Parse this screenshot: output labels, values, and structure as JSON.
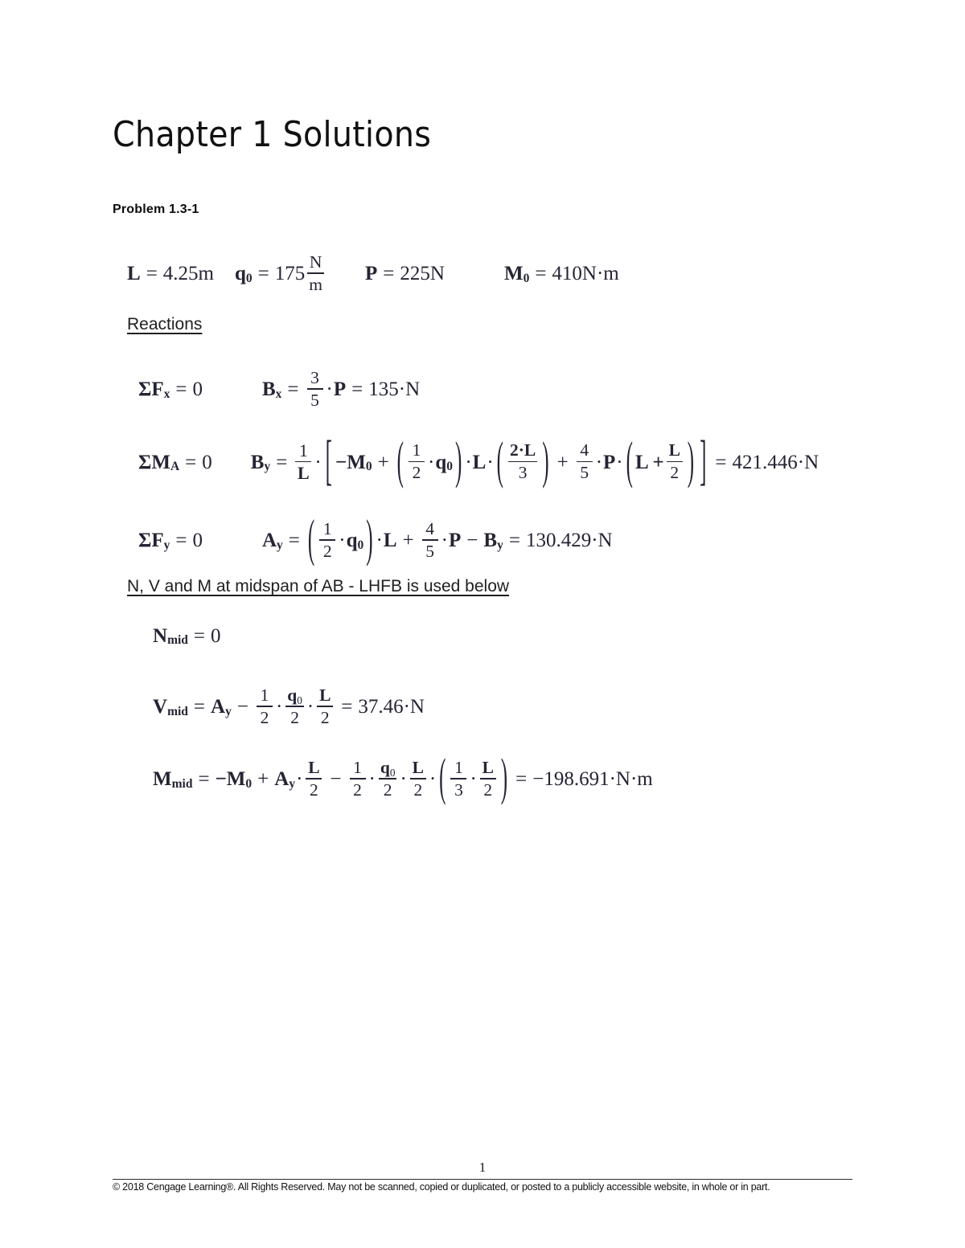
{
  "document": {
    "title": "Chapter 1 Solutions",
    "problem_label": "Problem 1.3-1"
  },
  "givens": {
    "L": {
      "name": "L",
      "eq": "=",
      "value": "4.25m"
    },
    "q0": {
      "name": "q",
      "sub": "0",
      "eq": "=",
      "value": "175",
      "unit_num": "N",
      "unit_den": "m"
    },
    "P": {
      "name": "P",
      "eq": "=",
      "value": "225N"
    },
    "M0": {
      "name": "M",
      "sub": "0",
      "eq": "=",
      "value": "410N·m"
    }
  },
  "sections": {
    "reactions": {
      "heading": "Reactions"
    },
    "nvm": {
      "heading": "N, V and M at midspan of AB - LHFB is used below"
    }
  },
  "equations": {
    "sum_fx": {
      "condition_sym": "ΣF",
      "condition_sub": "x",
      "condition_eq": "=",
      "condition_val": "0",
      "lhs_sym": "B",
      "lhs_sub": "x",
      "frac_num": "3",
      "frac_den": "5",
      "factor": "P",
      "result": "135·N"
    },
    "sum_ma": {
      "condition_sym": "ΣM",
      "condition_sub": "A",
      "condition_eq": "=",
      "condition_val": "0",
      "lhs_sym": "B",
      "lhs_sub": "y",
      "outer_num": "1",
      "outer_den": "L",
      "term1": "−M",
      "term1_sub": "0",
      "t2_num": "1",
      "t2_den": "2",
      "t2_var": "q",
      "t2_var_sub": "0",
      "t2_mult": "L",
      "t3_num": "2·L",
      "t3_den": "3",
      "t4_num": "4",
      "t4_den": "5",
      "t4_var": "P",
      "t5_lead": "L +",
      "t5_num": "L",
      "t5_den": "2",
      "result": "421.446·N"
    },
    "sum_fy": {
      "condition_sym": "ΣF",
      "condition_sub": "y",
      "condition_eq": "=",
      "condition_val": "0",
      "lhs_sym": "A",
      "lhs_sub": "y",
      "t1_num": "1",
      "t1_den": "2",
      "t1_var": "q",
      "t1_var_sub": "0",
      "t1_mult": "L",
      "t2_num": "4",
      "t2_den": "5",
      "t2_var": "P",
      "minus_var": "B",
      "minus_var_sub": "y",
      "result": "130.429·N"
    },
    "n_mid": {
      "lhs_sym": "N",
      "lhs_sub": "mid",
      "eq": "=",
      "result": "0"
    },
    "v_mid": {
      "lhs_sym": "V",
      "lhs_sub": "mid",
      "t1_sym": "A",
      "t1_sub": "y",
      "f1_num": "1",
      "f1_den": "2",
      "f2_num": "q",
      "f2_num_sub": "0",
      "f2_den": "2",
      "f3_num": "L",
      "f3_den": "2",
      "result": "37.46·N"
    },
    "m_mid": {
      "lhs_sym": "M",
      "lhs_sub": "mid",
      "t1": "−M",
      "t1_sub": "0",
      "t2_sym": "A",
      "t2_sub": "y",
      "f0_num": "L",
      "f0_den": "2",
      "f1_num": "1",
      "f1_den": "2",
      "f2_num": "q",
      "f2_num_sub": "0",
      "f2_den": "2",
      "f3_num": "L",
      "f3_den": "2",
      "f4_num": "1",
      "f4_den": "3",
      "f5_num": "L",
      "f5_den": "2",
      "result": "−198.691·N·m"
    }
  },
  "footer": {
    "page_number": "1",
    "copyright": "© 2018 Cengage Learning®. All Rights Reserved. May not be scanned, copied or duplicated, or posted to a publicly accessible website, in whole or in part."
  },
  "symbols": {
    "equals": "=",
    "plus": "+",
    "minus": "−",
    "cdot": "·",
    "lparen": "(",
    "rparen": ")",
    "lbracket": "[",
    "rbracket": "]"
  }
}
